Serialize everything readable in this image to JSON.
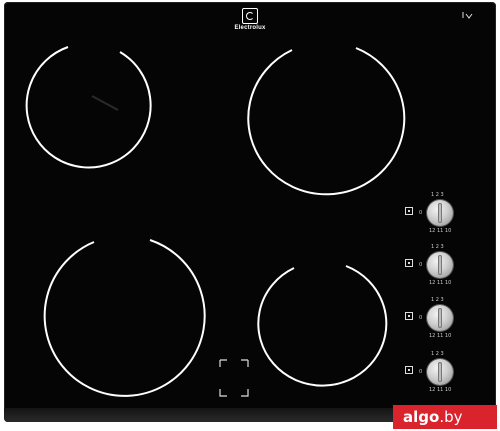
{
  "product": {
    "brand_name": "Electrolux",
    "corner_mark": "?"
  },
  "knob_scale": {
    "top": "1  2  3",
    "right": "4\n5\n6\n7",
    "bottom": "12  11  10",
    "left": "0"
  },
  "watermark": {
    "name": "algo",
    "dot": ".",
    "tld": "by"
  },
  "colors": {
    "glass": "#050505",
    "zone_lines": "#ffffff",
    "knob": "#cfcfcf",
    "watermark_bg": "#d9232d"
  },
  "icons": {
    "brand": "electrolux-logo-icon",
    "touch": "touch-control-icon",
    "zone_symbol": "zone-position-icon"
  }
}
